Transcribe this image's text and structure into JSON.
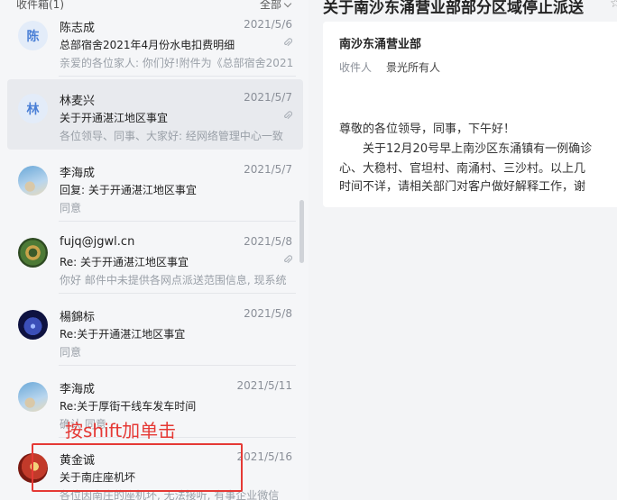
{
  "list": {
    "folder": "收件箱(1)",
    "filter": "全部",
    "items": [
      {
        "avatar": "陈",
        "sender": "陈志成",
        "date": "2021/5/6",
        "subject": "总部宿舍2021年4月份水电扣费明细",
        "preview": "亲爱的各位家人: 你们好!附件为《总部宿舍2021",
        "attachment": true
      },
      {
        "avatar": "林",
        "sender": "林麦兴",
        "date": "2021/5/7",
        "subject": "关于开通湛江地区事宜",
        "preview": "各位领导、同事、大家好:  经网络管理中心一致",
        "attachment": true
      },
      {
        "avatar": "",
        "sender": "李海成",
        "date": "2021/5/7",
        "subject": "回复: 关于开通湛江地区事宜",
        "preview": "同意",
        "attachment": false
      },
      {
        "avatar": "",
        "sender": "fujq@jgwl.cn",
        "date": "2021/5/8",
        "subject": "Re: 关于开通湛江地区事宜",
        "preview": "你好 邮件中未提供各网点派送范围信息, 现系统",
        "attachment": true
      },
      {
        "avatar": "",
        "sender": "楊錦标",
        "date": "2021/5/8",
        "subject": "Re:关于开通湛江地区事宜",
        "preview": "同意",
        "attachment": false
      },
      {
        "avatar": "",
        "sender": "李海成",
        "date": "2021/5/11",
        "subject": "Re:关于厚街干线车发车时间",
        "preview": "确认 同意",
        "attachment": false
      },
      {
        "avatar": "",
        "sender": "黄金诚",
        "date": "2021/5/16",
        "subject": "关于南庄座机坏",
        "preview": "各位因南庄的座机坏, 无法接听, 有事企业微信",
        "attachment": false
      }
    ]
  },
  "annotation": "按shift加单击",
  "reader": {
    "title": "关于南沙东涌营业部部分区域停止派送",
    "from": "南沙东涌营业部",
    "to_label": "收件人",
    "to_value": "景光所有人",
    "body": [
      "尊敬的各位领导，同事，下午好！",
      "　　关于12月20号早上南沙区东涌镇有一例确诊",
      "心、大稳村、官坦村、南涌村、三沙村。以上几",
      "时间不详，请相关部门对客户做好解释工作，谢"
    ]
  },
  "colors": {
    "accent": "#4a7fd6",
    "annotation": "#e53935"
  },
  "icons": {
    "attachment": "paperclip-icon",
    "star": "star-icon",
    "chevron": "chevron-down-icon"
  }
}
